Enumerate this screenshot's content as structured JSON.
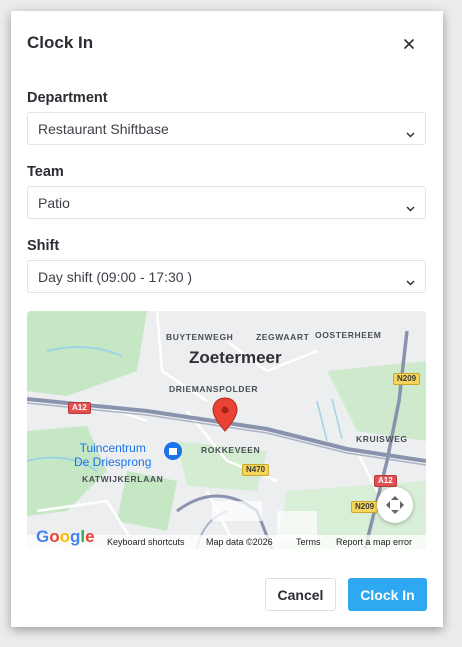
{
  "dialog": {
    "title": "Clock In",
    "close_icon": "close-icon"
  },
  "fields": {
    "department": {
      "label": "Department",
      "value": "Restaurant Shiftbase"
    },
    "team": {
      "label": "Team",
      "value": "Patio"
    },
    "shift": {
      "label": "Shift",
      "value": "Day shift (09:00 - 17:30 )"
    }
  },
  "map": {
    "city": "Zoetermeer",
    "districts": [
      "BUYTENWEGH",
      "ZEGWAART",
      "OOSTERHEEM",
      "DRIEMANSPOLDER",
      "ROKKEVEEN",
      "KRUISWEG",
      "KATWIJKERLAAN"
    ],
    "poi": {
      "line1": "Tuincentrum",
      "line2": "De Driesprong"
    },
    "roads": [
      "A12",
      "N209",
      "N470",
      "A12",
      "N209"
    ],
    "logo": "Google",
    "footer": {
      "shortcuts": "Keyboard shortcuts",
      "data": "Map data ©2026",
      "terms": "Terms",
      "report": "Report a map error"
    },
    "colors": {
      "water": "#9dd3e6",
      "park": "#c6e7c4",
      "road": "#8a93ad",
      "pin": "#ea4335"
    }
  },
  "actions": {
    "cancel": "Cancel",
    "submit": "Clock In"
  },
  "colors": {
    "primary": "#2da8f1"
  }
}
